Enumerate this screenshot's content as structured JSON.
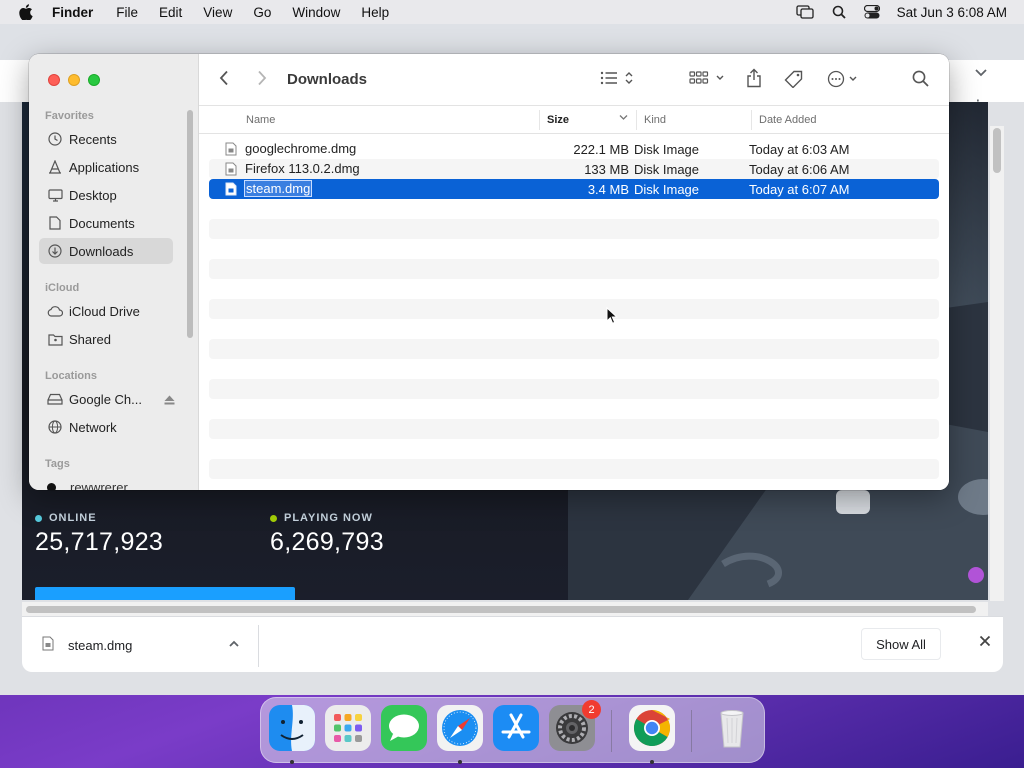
{
  "menubar": {
    "app_name": "Finder",
    "items": [
      "File",
      "Edit",
      "View",
      "Go",
      "Window",
      "Help"
    ],
    "clock": "Sat Jun 3  6:08 AM"
  },
  "finder": {
    "title": "Downloads",
    "sidebar": {
      "favorites_label": "Favorites",
      "favorites": [
        {
          "label": "Recents",
          "icon": "clock-icon"
        },
        {
          "label": "Applications",
          "icon": "applications-icon"
        },
        {
          "label": "Desktop",
          "icon": "desktop-icon"
        },
        {
          "label": "Documents",
          "icon": "document-icon"
        },
        {
          "label": "Downloads",
          "icon": "download-icon",
          "active": true
        }
      ],
      "icloud_label": "iCloud",
      "icloud": [
        {
          "label": "iCloud Drive",
          "icon": "cloud-icon"
        },
        {
          "label": "Shared",
          "icon": "shared-folder-icon"
        }
      ],
      "locations_label": "Locations",
      "locations": [
        {
          "label": "Google Ch...",
          "icon": "drive-icon",
          "ejectable": true
        },
        {
          "label": "Network",
          "icon": "globe-icon"
        }
      ],
      "tags_label": "Tags",
      "tags": [
        {
          "label": "rewwrerer",
          "color": "#111111"
        }
      ]
    },
    "columns": {
      "name": "Name",
      "size": "Size",
      "kind": "Kind",
      "date_added": "Date Added"
    },
    "files": [
      {
        "name": "googlechrome.dmg",
        "size": "222.1 MB",
        "kind": "Disk Image",
        "date_added": "Today at 6:03 AM"
      },
      {
        "name": "Firefox 113.0.2.dmg",
        "size": "133 MB",
        "kind": "Disk Image",
        "date_added": "Today at 6:06 AM"
      },
      {
        "name": "steam.dmg",
        "size": "3.4 MB",
        "kind": "Disk Image",
        "date_added": "Today at 6:07 AM",
        "selected": true
      }
    ]
  },
  "steam": {
    "online_label": "ONLINE",
    "online_value": "25,717,923",
    "playing_label": "PLAYING NOW",
    "playing_value": "6,269,793",
    "online_color": "#57cbde",
    "playing_color": "#a4d007"
  },
  "download_shelf": {
    "file_name": "steam.dmg",
    "show_all": "Show All"
  },
  "dock": {
    "items": [
      "Finder",
      "Launchpad",
      "Messages",
      "Safari",
      "App Store",
      "System Settings",
      "Google Chrome",
      "Trash"
    ],
    "settings_badge": "2"
  },
  "colors": {
    "selection": "#0a62d6",
    "accent": "#1a9fff"
  }
}
